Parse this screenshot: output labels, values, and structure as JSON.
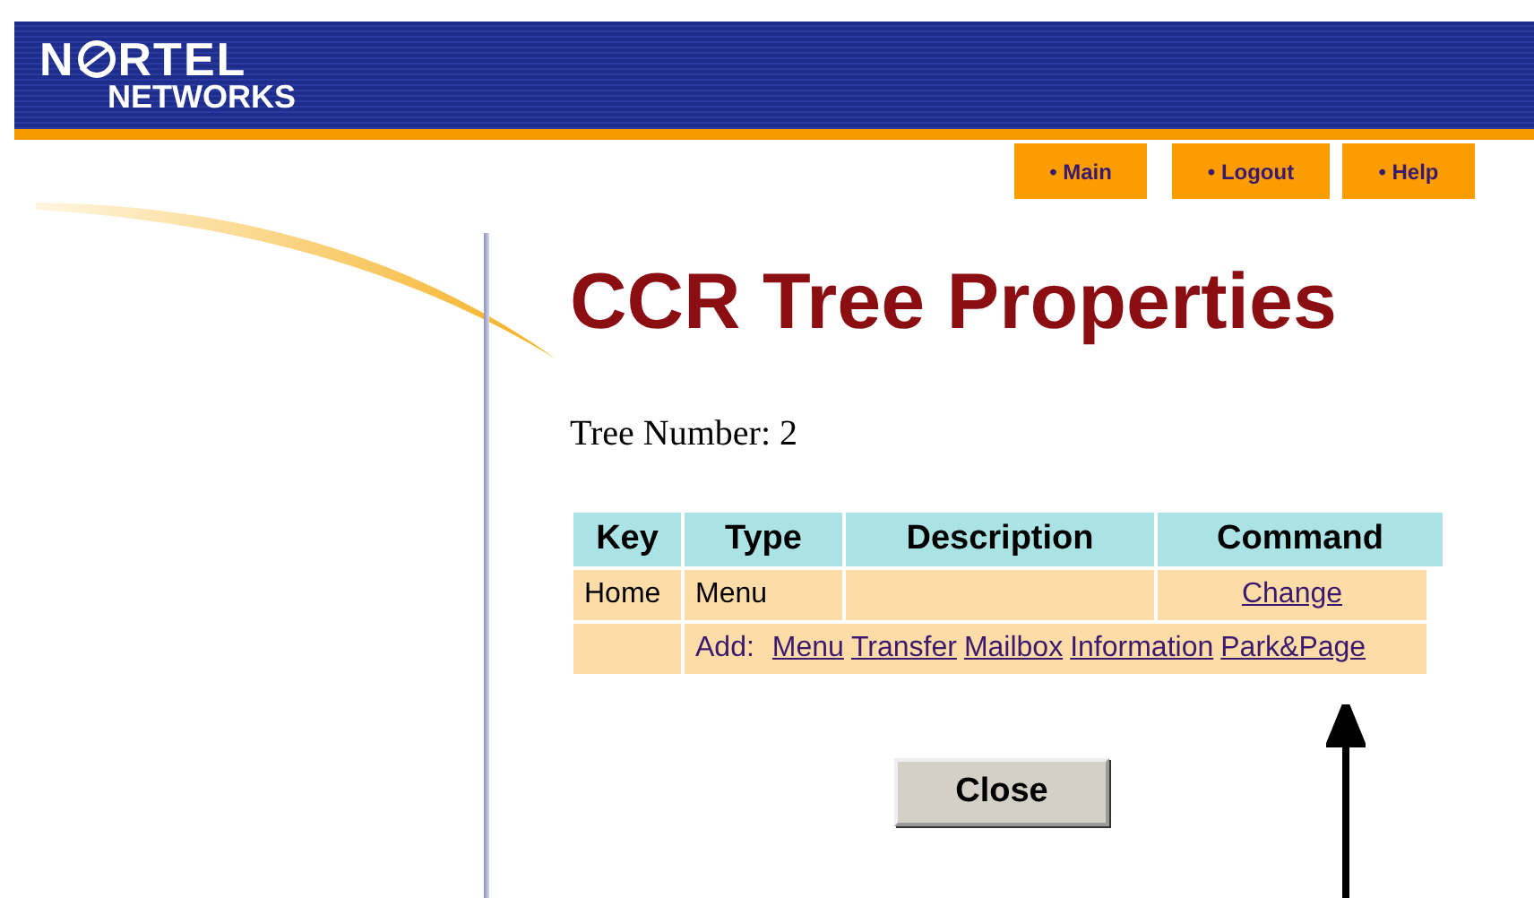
{
  "logo": {
    "first_letter": "N",
    "rest_of_word": "RTEL",
    "second_line": "NETWORKS"
  },
  "nav": [
    {
      "label": "• Main"
    },
    {
      "label": "• Logout"
    },
    {
      "label": "• Help"
    }
  ],
  "title": "CCR Tree Properties",
  "tree_number": "Tree Number: 2",
  "table": {
    "columns": [
      "Key",
      "Type",
      "Description",
      "Command"
    ],
    "rows": [
      {
        "key": "Home",
        "type": "Menu",
        "description": "",
        "command": "Change"
      }
    ],
    "add_row": {
      "label": "Add:",
      "links": [
        "Menu",
        "Transfer",
        "Mailbox",
        "Information",
        "Park&Page"
      ]
    }
  },
  "close_button": "Close"
}
